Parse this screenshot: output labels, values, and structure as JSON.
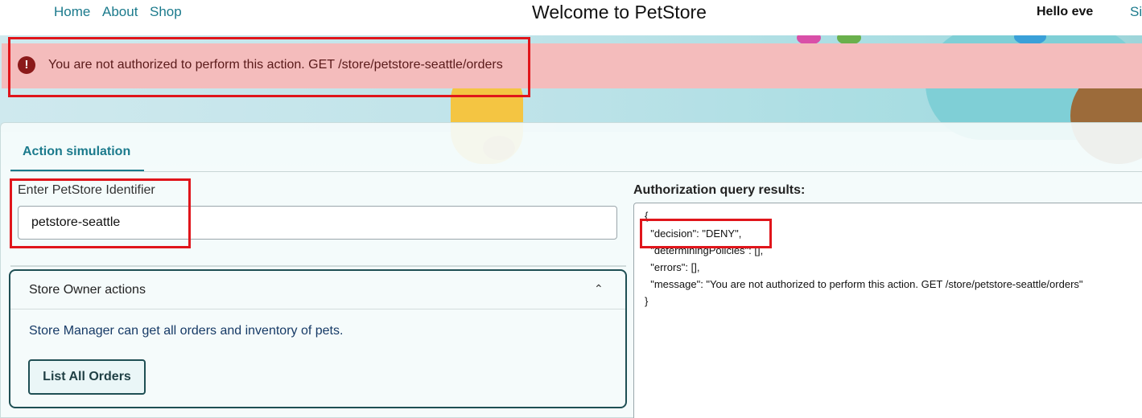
{
  "nav": {
    "home": "Home",
    "about": "About",
    "shop": "Shop"
  },
  "header": {
    "title": "Welcome to PetStore",
    "greeting": "Hello eve",
    "signout": "Si"
  },
  "alert": {
    "icon": "!",
    "message": "You are not authorized to perform this action. GET /store/petstore-seattle/orders"
  },
  "tabs": {
    "active": "Action simulation"
  },
  "identifier": {
    "label": "Enter PetStore Identifier",
    "value": "petstore-seattle"
  },
  "store_owner": {
    "title": "Store Owner actions",
    "chevron": "⌃",
    "description": "Store Manager can get all orders and inventory of pets.",
    "button": "List All Orders"
  },
  "results": {
    "label": "Authorization query results:",
    "lines": [
      "{",
      "  \"decision\": \"DENY\",",
      "  \"determiningPolicies\": [],",
      "  \"errors\": [],",
      "  \"message\": \"You are not authorized to perform this action. GET /store/petstore-seattle/orders\"",
      "}"
    ]
  },
  "colors": {
    "accent": "#1b7a8c",
    "alert_bg": "#f4bcbc",
    "alert_icon": "#8b1a1a",
    "highlight": "#e0151b"
  }
}
